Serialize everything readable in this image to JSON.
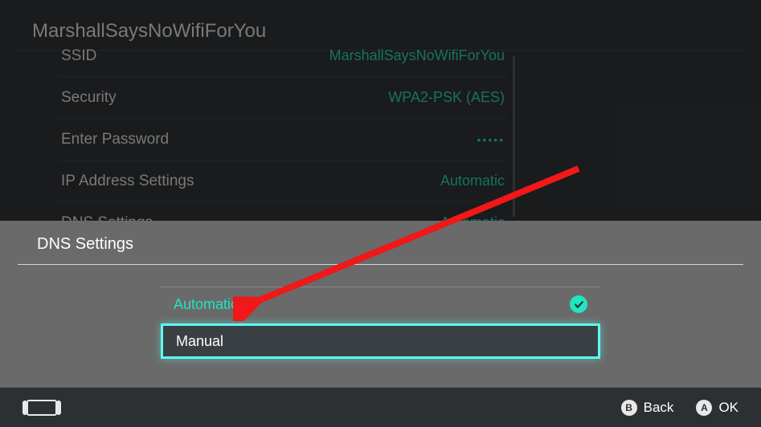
{
  "page": {
    "title": "MarshallSaysNoWifiForYou"
  },
  "settings": {
    "rows": [
      {
        "label": "SSID",
        "value": "MarshallSaysNoWifiForYou"
      },
      {
        "label": "Security",
        "value": "WPA2-PSK (AES)"
      },
      {
        "label": "Enter Password",
        "value": "•••••"
      },
      {
        "label": "IP Address Settings",
        "value": "Automatic"
      },
      {
        "label": "DNS Settings",
        "value": "Automatic"
      }
    ]
  },
  "modal": {
    "title": "DNS Settings",
    "options": {
      "automatic": "Automatic",
      "manual": "Manual"
    }
  },
  "footer": {
    "hints": {
      "back": {
        "button": "B",
        "label": "Back"
      },
      "ok": {
        "button": "A",
        "label": "OK"
      }
    }
  }
}
